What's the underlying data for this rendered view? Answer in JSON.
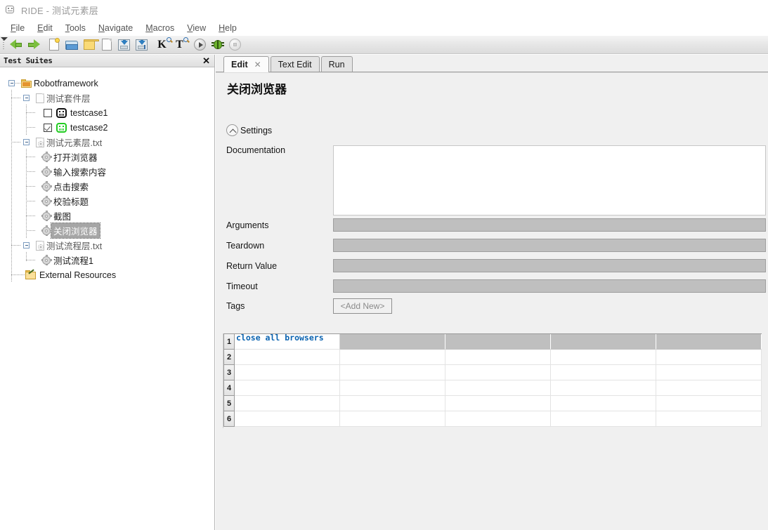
{
  "window": {
    "title": "RIDE - 测试元素层",
    "icon": "robot-icon"
  },
  "menubar": {
    "items": [
      {
        "label": "File",
        "mnemonic": "F"
      },
      {
        "label": "Edit",
        "mnemonic": "E"
      },
      {
        "label": "Tools",
        "mnemonic": "T"
      },
      {
        "label": "Navigate",
        "mnemonic": "N"
      },
      {
        "label": "Macros",
        "mnemonic": "M"
      },
      {
        "label": "View",
        "mnemonic": "V"
      },
      {
        "label": "Help",
        "mnemonic": "H"
      }
    ]
  },
  "toolbar": {
    "buttons": [
      {
        "name": "back-arrow-icon"
      },
      {
        "name": "forward-arrow-icon"
      },
      {
        "name": "new-project-icon"
      },
      {
        "name": "open-directory-icon"
      },
      {
        "name": "open-folder-icon"
      },
      {
        "name": "new-file-icon"
      },
      {
        "name": "save-icon"
      },
      {
        "name": "save-all-icon"
      },
      {
        "name": "search-keyword-icon",
        "glyph": "K"
      },
      {
        "name": "search-test-icon",
        "glyph": "T"
      },
      {
        "name": "run-icon"
      },
      {
        "name": "debug-icon"
      },
      {
        "name": "stop-icon"
      }
    ]
  },
  "tree_panel": {
    "header": "Test Suites",
    "close_icon": "✕",
    "nodes": [
      {
        "label": "Robotframework",
        "icon": "folder-icon",
        "depth": 0,
        "expanded": true,
        "selected": false
      },
      {
        "label": "测试套件层",
        "icon": "document-icon",
        "depth": 1,
        "expanded": true,
        "selected": false
      },
      {
        "label": "testcase1",
        "icon": "robot-black-icon",
        "depth": 2,
        "checkbox": "unchecked",
        "selected": false
      },
      {
        "label": "testcase2",
        "icon": "robot-green-icon",
        "depth": 2,
        "checkbox": "checked",
        "selected": false
      },
      {
        "label": "测试元素层.txt",
        "icon": "resource-file-icon",
        "depth": 1,
        "expanded": true,
        "selected": false
      },
      {
        "label": "打开浏览器",
        "icon": "gear-icon",
        "depth": 2,
        "selected": false
      },
      {
        "label": "输入搜索内容",
        "icon": "gear-icon",
        "depth": 2,
        "selected": false
      },
      {
        "label": "点击搜索",
        "icon": "gear-icon",
        "depth": 2,
        "selected": false
      },
      {
        "label": "校验标题",
        "icon": "gear-icon",
        "depth": 2,
        "selected": false
      },
      {
        "label": "截图",
        "icon": "gear-icon",
        "depth": 2,
        "selected": false
      },
      {
        "label": "关闭浏览器",
        "icon": "gear-icon",
        "depth": 2,
        "selected": true
      },
      {
        "label": "测试流程层.txt",
        "icon": "resource-file-icon",
        "depth": 1,
        "expanded": true,
        "selected": false
      },
      {
        "label": "测试流程1",
        "icon": "gear-icon",
        "depth": 2,
        "selected": false
      },
      {
        "label": "External Resources",
        "icon": "external-resources-icon",
        "depth": 1,
        "selected": false
      }
    ]
  },
  "editor": {
    "tabs": [
      {
        "label": "Edit",
        "active": true,
        "closable": true,
        "close_icon": "✕"
      },
      {
        "label": "Text Edit",
        "active": false,
        "closable": false
      },
      {
        "label": "Run",
        "active": false,
        "closable": false
      }
    ],
    "keyword_title": "关闭浏览器",
    "settings_section": {
      "label": "Settings",
      "collapse_icon": "chevron-up-icon",
      "expanded": true
    },
    "fields": [
      {
        "label": "Documentation",
        "value": "",
        "type": "textarea"
      },
      {
        "label": "Arguments",
        "value": "",
        "type": "text"
      },
      {
        "label": "Teardown",
        "value": "",
        "type": "text"
      },
      {
        "label": "Return Value",
        "value": "",
        "type": "text"
      },
      {
        "label": "Timeout",
        "value": "",
        "type": "text"
      },
      {
        "label": "Tags",
        "value": "<Add New>",
        "type": "button"
      }
    ],
    "grid": {
      "row_numbers": [
        "1",
        "2",
        "3",
        "4",
        "5",
        "6"
      ],
      "columns": 5,
      "rows": [
        [
          "close all browsers",
          "",
          "",
          "",
          ""
        ],
        [
          "",
          "",
          "",
          "",
          ""
        ],
        [
          "",
          "",
          "",
          "",
          ""
        ],
        [
          "",
          "",
          "",
          "",
          ""
        ],
        [
          "",
          "",
          "",
          "",
          ""
        ],
        [
          "",
          "",
          "",
          "",
          ""
        ]
      ]
    }
  },
  "colors": {
    "keyword_text": "#0a63b0",
    "selection_bg": "#a6a6a6",
    "panel_bg": "#f0f0f0",
    "input_bg": "#bfbfbf",
    "accent_green": "#22cc22"
  }
}
